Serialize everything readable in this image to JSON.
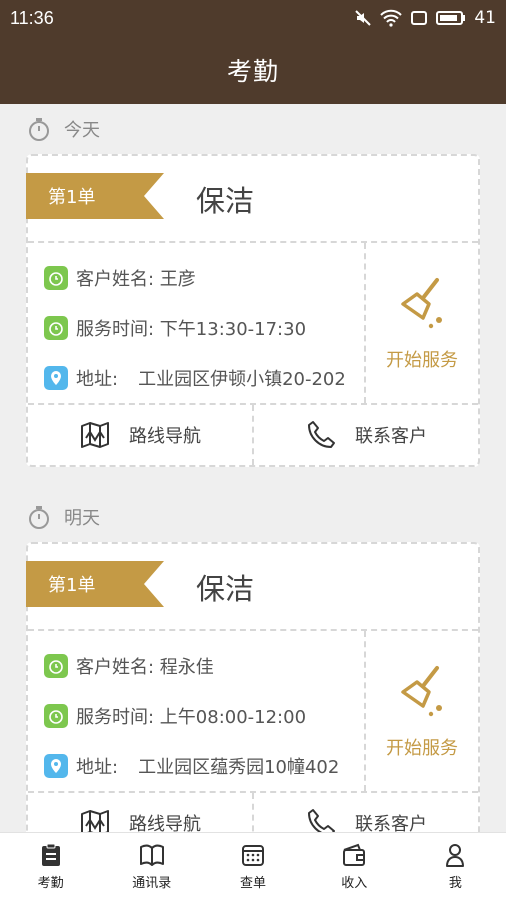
{
  "status_bar": {
    "time": "11:36",
    "battery": "41",
    "icons": [
      "mute-icon",
      "wifi-icon",
      "screen-icon",
      "battery-icon"
    ]
  },
  "header": {
    "title": "考勤"
  },
  "days": [
    {
      "label": "今天",
      "order": {
        "tag": "第1单",
        "service": "保洁",
        "customer": "客户姓名:  王彦",
        "time": "服务时间:  下午13:30-17:30",
        "address_label": "地址:",
        "address": "工业园区伊顿小镇20-202",
        "start": "开始服务",
        "nav": "路线导航",
        "contact": "联系客户"
      }
    },
    {
      "label": "明天",
      "order": {
        "tag": "第1单",
        "service": "保洁",
        "customer": "客户姓名:  程永佳",
        "time": "服务时间:  上午08:00-12:00",
        "address_label": "地址:",
        "address": "工业园区蕴秀园10幢402",
        "start": "开始服务",
        "nav": "路线导航",
        "contact": "联系客户"
      }
    }
  ],
  "tabs": [
    {
      "label": "考勤",
      "icon": "clipboard-icon",
      "active": true
    },
    {
      "label": "通讯录",
      "icon": "book-icon"
    },
    {
      "label": "查单",
      "icon": "calendar-icon"
    },
    {
      "label": "收入",
      "icon": "wallet-icon"
    },
    {
      "label": "我",
      "icon": "person-icon"
    }
  ],
  "colors": {
    "header_bg": "#4f3b2c",
    "accent_gold": "#c49a45",
    "green": "#7dc74e",
    "blue": "#53b7ec"
  }
}
